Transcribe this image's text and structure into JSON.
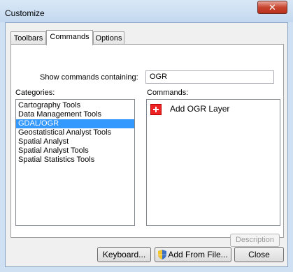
{
  "window": {
    "title": "Customize",
    "close_label": "✕"
  },
  "tabs": [
    {
      "label": "Toolbars"
    },
    {
      "label": "Commands"
    },
    {
      "label": "Options"
    }
  ],
  "active_tab": "Commands",
  "search": {
    "label": "Show commands containing:",
    "value": "OGR"
  },
  "categories": {
    "label": "Categories:",
    "items": [
      "Cartography Tools",
      "Data Management Tools",
      "GDAL/OGR",
      "Geostatistical Analyst Tools",
      "Spatial Analyst",
      "Spatial Analyst Tools",
      "Spatial Statistics Tools"
    ],
    "selected": "GDAL/OGR"
  },
  "commands": {
    "label": "Commands:",
    "items": [
      {
        "label": "Add OGR Layer",
        "icon": "add-layer-icon"
      }
    ]
  },
  "buttons": {
    "description": "Description",
    "keyboard": "Keyboard...",
    "add_from_file": "Add From File...",
    "close": "Close"
  }
}
